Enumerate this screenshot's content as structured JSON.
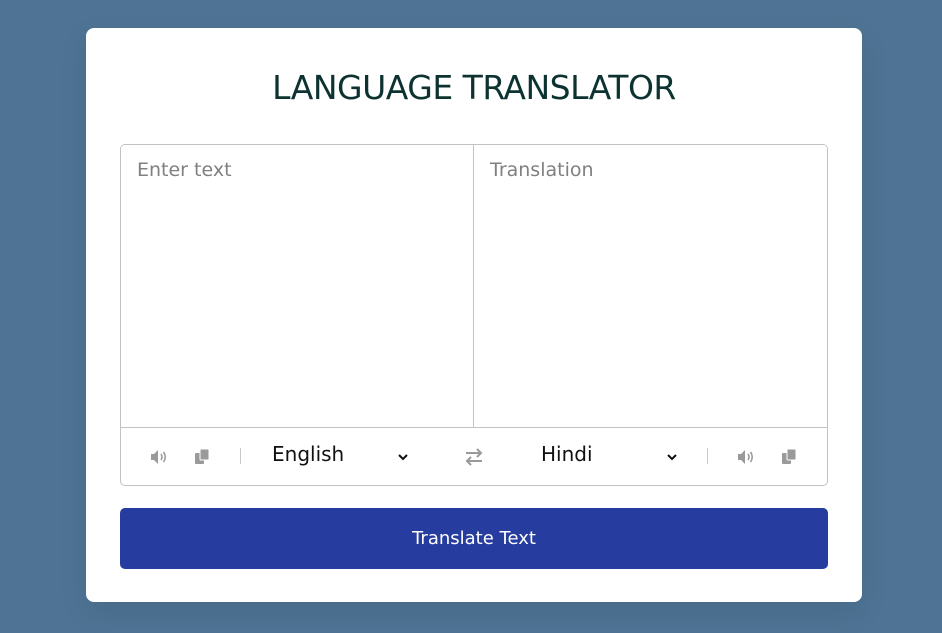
{
  "app": {
    "title": "LANGUAGE TRANSLATOR"
  },
  "input": {
    "from_placeholder": "Enter text",
    "from_value": "",
    "to_placeholder": "Translation",
    "to_value": ""
  },
  "from_controls": {
    "speak_icon": "volume-icon",
    "copy_icon": "copy-icon",
    "language": "English"
  },
  "to_controls": {
    "speak_icon": "volume-icon",
    "copy_icon": "copy-icon",
    "language": "Hindi"
  },
  "exchange_icon": "exchange-icon",
  "action": {
    "translate_label": "Translate Text"
  },
  "colors": {
    "background": "#4e7394",
    "title": "#0d3330",
    "button": "#263c9e",
    "icon": "#9a9a9a"
  }
}
